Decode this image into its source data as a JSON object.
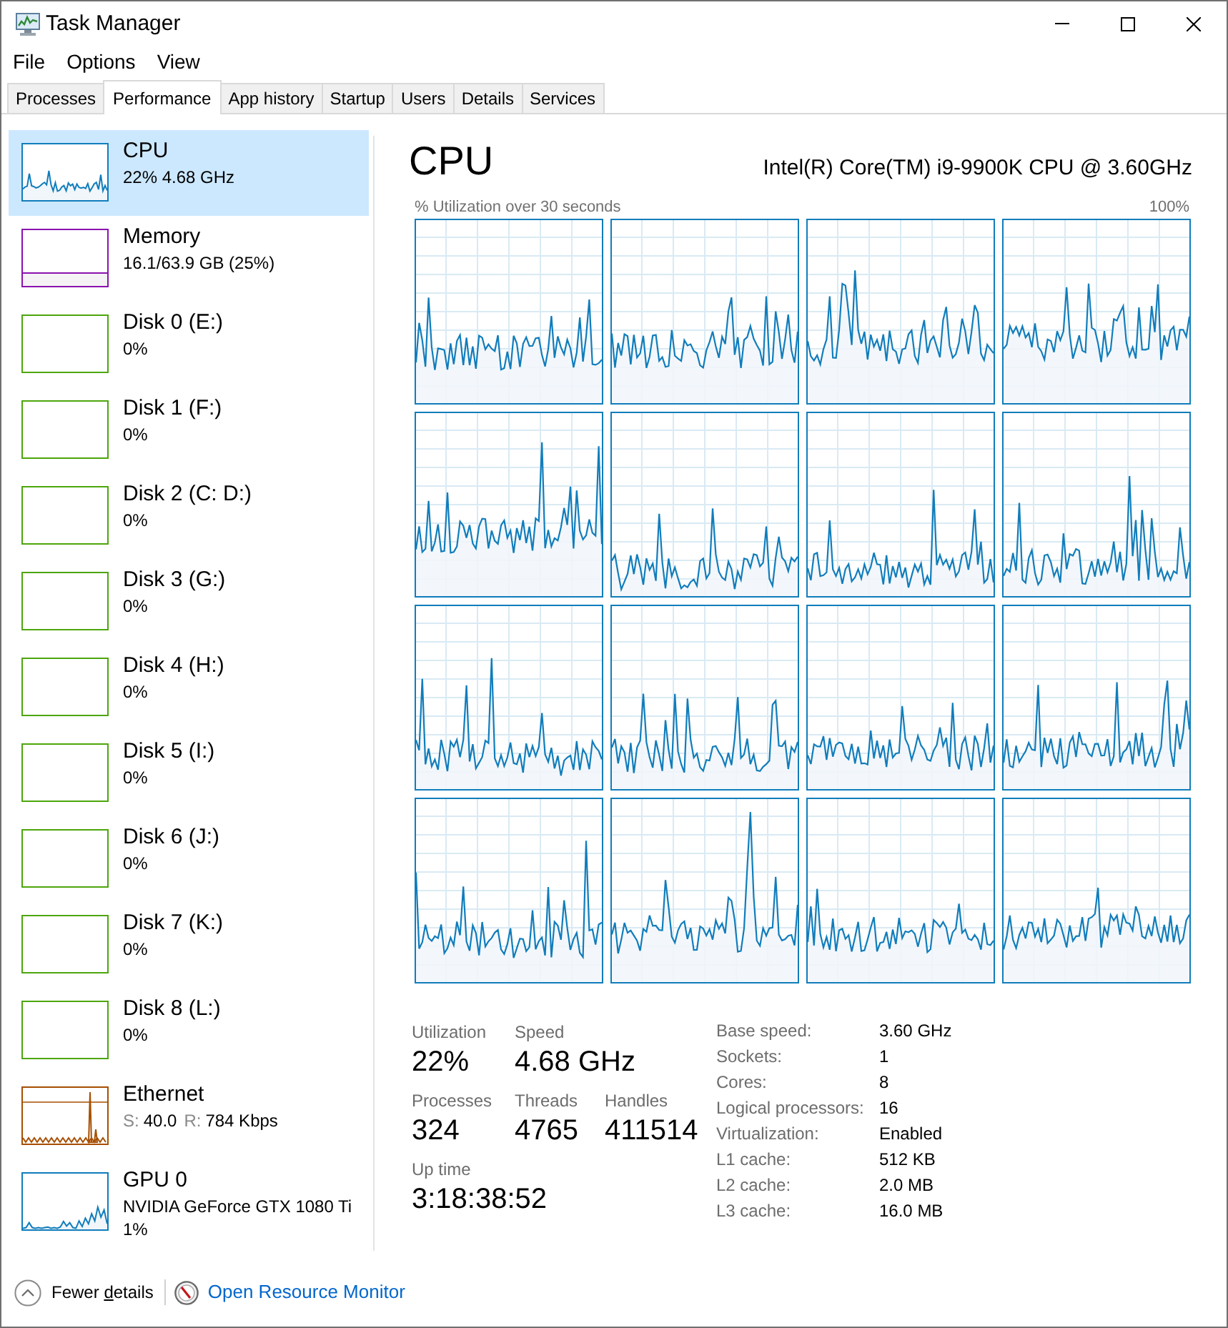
{
  "window": {
    "title": "Task Manager"
  },
  "menu": [
    "File",
    "Options",
    "View"
  ],
  "tabs": [
    {
      "label": "Processes",
      "selected": false
    },
    {
      "label": "Performance",
      "selected": true
    },
    {
      "label": "App history",
      "selected": false
    },
    {
      "label": "Startup",
      "selected": false
    },
    {
      "label": "Users",
      "selected": false
    },
    {
      "label": "Details",
      "selected": false
    },
    {
      "label": "Services",
      "selected": false
    }
  ],
  "sidebar": {
    "items": [
      {
        "kind": "cpu",
        "title": "CPU",
        "lines": [
          "22% 4.68 GHz"
        ],
        "selected": true
      },
      {
        "kind": "memory",
        "title": "Memory",
        "lines": [
          "16.1/63.9 GB (25%)"
        ],
        "selected": false
      },
      {
        "kind": "disk",
        "title": "Disk 0 (E:)",
        "lines": [
          "0%"
        ],
        "selected": false
      },
      {
        "kind": "disk",
        "title": "Disk 1 (F:)",
        "lines": [
          "0%"
        ],
        "selected": false
      },
      {
        "kind": "disk",
        "title": "Disk 2 (C: D:)",
        "lines": [
          "0%"
        ],
        "selected": false
      },
      {
        "kind": "disk",
        "title": "Disk 3 (G:)",
        "lines": [
          "0%"
        ],
        "selected": false
      },
      {
        "kind": "disk",
        "title": "Disk 4 (H:)",
        "lines": [
          "0%"
        ],
        "selected": false
      },
      {
        "kind": "disk",
        "title": "Disk 5 (I:)",
        "lines": [
          "0%"
        ],
        "selected": false
      },
      {
        "kind": "disk",
        "title": "Disk 6 (J:)",
        "lines": [
          "0%"
        ],
        "selected": false
      },
      {
        "kind": "disk",
        "title": "Disk 7 (K:)",
        "lines": [
          "0%"
        ],
        "selected": false
      },
      {
        "kind": "disk",
        "title": "Disk 8 (L:)",
        "lines": [
          "0%"
        ],
        "selected": false
      },
      {
        "kind": "ethernet",
        "title": "Ethernet",
        "readings": [
          {
            "label": "S:",
            "value": "40.0"
          },
          {
            "label": "R:",
            "value": "784 Kbps"
          }
        ],
        "selected": false
      },
      {
        "kind": "gpu",
        "title": "GPU 0",
        "lines": [
          "NVIDIA GeForce GTX 1080 Ti",
          "1%"
        ],
        "selected": false
      }
    ]
  },
  "performance": {
    "title": "CPU",
    "processor": "Intel(R) Core(TM) i9-9900K CPU @ 3.60GHz",
    "graph": {
      "caption": "% Utilization over 30 seconds",
      "max_label": "100%"
    },
    "stats": [
      [
        {
          "label": "Utilization",
          "value": "22%"
        },
        {
          "label": "Speed",
          "value": "4.68 GHz"
        }
      ],
      [
        {
          "label": "Processes",
          "value": "324"
        },
        {
          "label": "Threads",
          "value": "4765"
        },
        {
          "label": "Handles",
          "value": "411514"
        }
      ],
      [
        {
          "label": "Up time",
          "value": "3:18:38:52"
        }
      ]
    ],
    "specs": [
      {
        "label": "Base speed:",
        "value": "3.60 GHz"
      },
      {
        "label": "Sockets:",
        "value": "1"
      },
      {
        "label": "Cores:",
        "value": "8"
      },
      {
        "label": "Logical processors:",
        "value": "16"
      },
      {
        "label": "Virtualization:",
        "value": "Enabled"
      },
      {
        "label": "L1 cache:",
        "value": "512 KB"
      },
      {
        "label": "L2 cache:",
        "value": "2.0 MB"
      },
      {
        "label": "L3 cache:",
        "value": "16.0 MB"
      }
    ]
  },
  "footer": {
    "fewer_details_parts": [
      "Fewer ",
      "d",
      "etails"
    ],
    "link": "Open Resource Monitor"
  }
}
